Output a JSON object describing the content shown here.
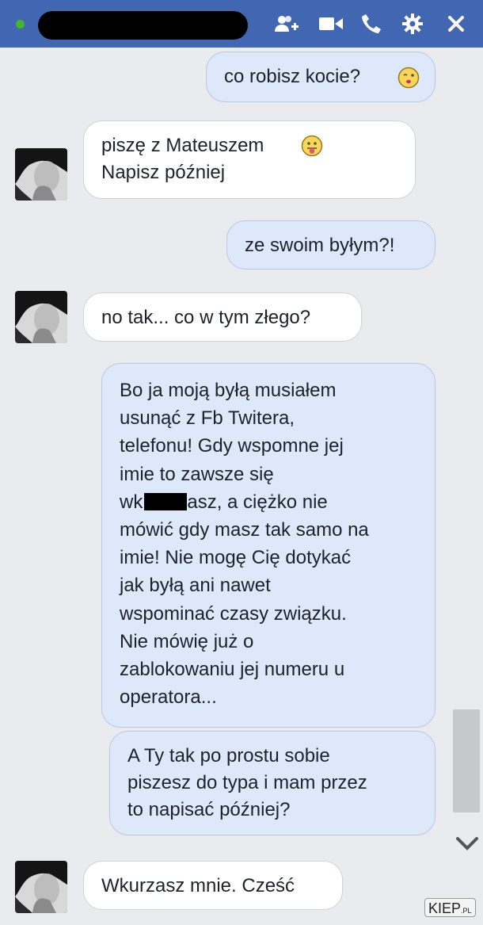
{
  "header": {
    "icons": [
      "add-people-icon",
      "video-call-icon",
      "phone-icon",
      "gear-icon",
      "close-icon"
    ]
  },
  "messages": [
    {
      "side": "out",
      "lines": [
        "co robisz kocie?"
      ],
      "emoji": "kissing-face"
    },
    {
      "side": "in",
      "lines": [
        "piszę z Mateuszem",
        "Napisz później"
      ],
      "emoji": "tongue-face"
    },
    {
      "side": "out",
      "lines": [
        "ze swoim byłym?!"
      ]
    },
    {
      "side": "in",
      "lines": [
        "no tak... co w tym złego?"
      ]
    },
    {
      "side": "out",
      "lines": [
        "Bo ja moją byłą musiałem",
        "usunąć z Fb Twitera,",
        "telefonu! Gdy wspomne jej",
        "imie to zawsze się",
        "wk",
        "asz, a ciężko nie",
        "mówić gdy masz tak samo na",
        "imie! Nie mogę Cię dotykać",
        "jak byłą ani nawet",
        "wspominać czasy związku.",
        "Nie mówię już o",
        "zablokowaniu jej numeru u",
        "operatora..."
      ]
    },
    {
      "side": "out",
      "lines": [
        "A Ty tak po prostu sobie",
        "piszesz do typa i mam przez",
        "to napisać później?"
      ]
    },
    {
      "side": "in",
      "lines": [
        "Wkurzasz mnie. Cześć"
      ]
    }
  ],
  "watermark": {
    "text": "KIEP",
    "suffix": ".PL"
  },
  "colors": {
    "header": "#4267b2",
    "online": "#42b72a",
    "bubble_out": "#dde9fa",
    "bubble_in": "#ffffff",
    "background": "#e9ebee"
  }
}
